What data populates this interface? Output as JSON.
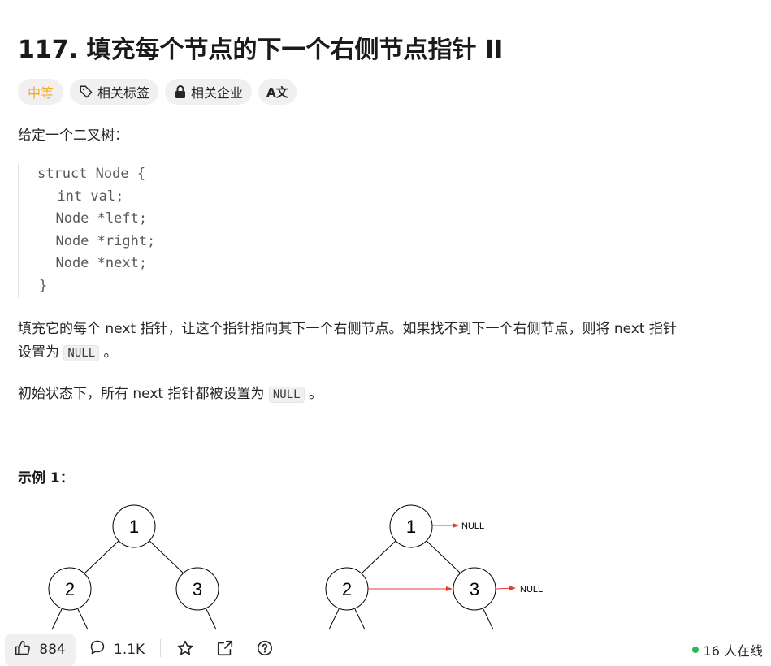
{
  "problem": {
    "number_title": "117. 填充每个节点的下一个右侧节点指针 II"
  },
  "tags": {
    "difficulty": "中等",
    "related_tags": "相关标签",
    "related_companies": "相关企业",
    "translate": "A文"
  },
  "description": {
    "intro": "给定一个二叉树：",
    "code_lines": [
      "struct Node {",
      "  int val;",
      "  Node *left;",
      "  Node *right;",
      "  Node *next;",
      "}"
    ],
    "para1_part1": "填充它的每个 next 指针，让这个指针指向其下一个右侧节点。如果找不到下一个右侧节点，则将 next 指针",
    "para1_part2_prefix": "设置为 ",
    "para1_code": "NULL",
    "para1_suffix": " 。",
    "para2_prefix": "初始状态下，所有 next 指针都被设置为 ",
    "para2_code": "NULL",
    "para2_suffix": " 。"
  },
  "example": {
    "heading": "示例 1：",
    "left_tree": {
      "nodes": [
        "1",
        "2",
        "3"
      ]
    },
    "right_tree": {
      "nodes": [
        "1",
        "2",
        "3"
      ],
      "null_labels": [
        "NULL",
        "NULL"
      ]
    }
  },
  "bottom_bar": {
    "likes": "884",
    "comments": "1.1K",
    "online": "16 人在线"
  },
  "colors": {
    "difficulty": "#f5a623",
    "arrow": "#e53935",
    "online_dot": "#2db55d"
  }
}
